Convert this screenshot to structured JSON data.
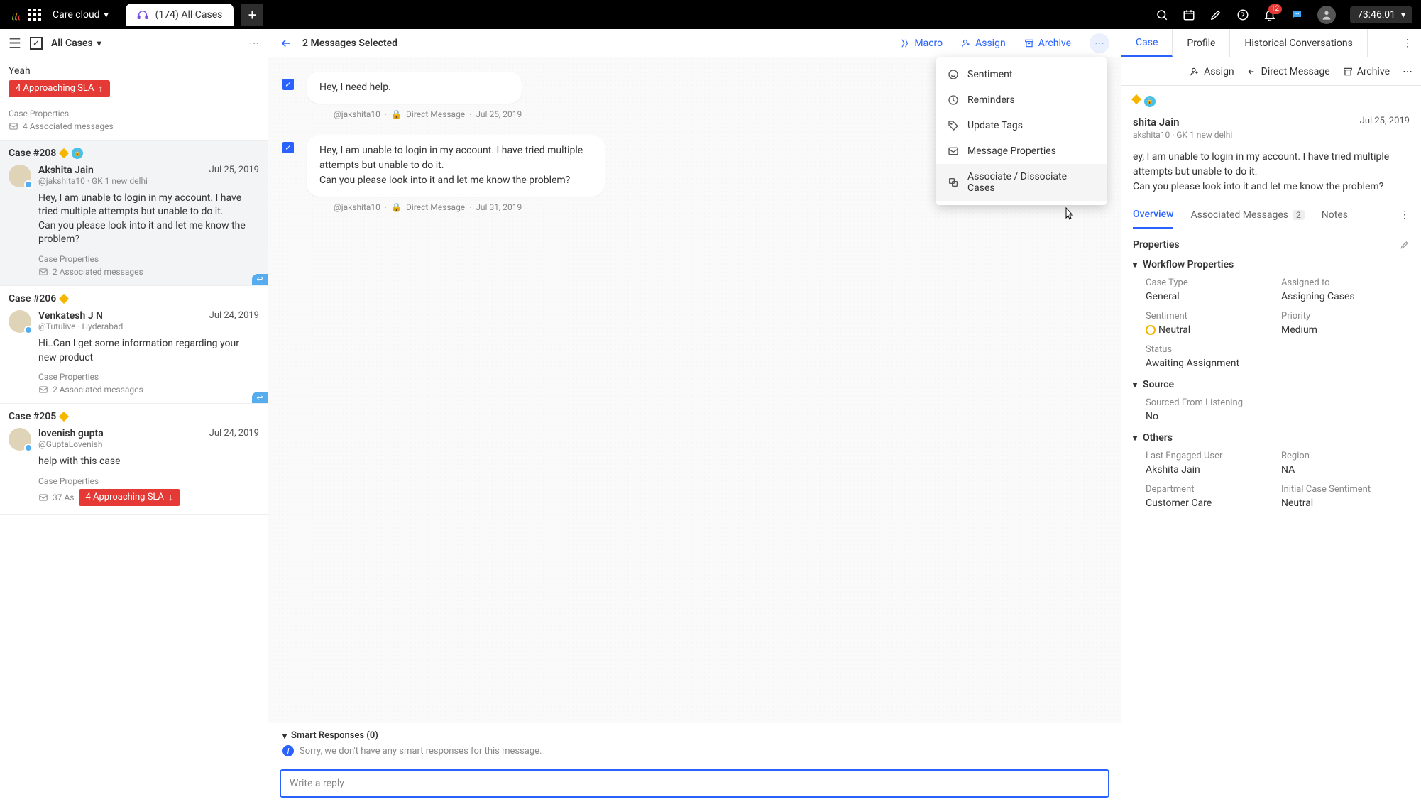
{
  "topbar": {
    "workspace": "Care cloud",
    "tab": {
      "label": "(174) All Cases"
    },
    "notif_count": "12",
    "timer": "73:46:01"
  },
  "cases_header": {
    "title": "All Cases"
  },
  "cases": [
    {
      "num": "",
      "author": "",
      "handle": "",
      "date": "",
      "text": "Yeah",
      "sla": "4 Approaching SLA",
      "case_props": "Case Properties",
      "assoc": "4 Associated messages"
    },
    {
      "num": "Case #208",
      "author": "Akshita Jain",
      "handle": "@jakshita10 · GK 1 new delhi",
      "date": "Jul 25, 2019",
      "text": "Hey, I am unable to login in my account. I have tried multiple attempts but unable to do it.\nCan you please look into it and let me know the problem?",
      "case_props": "Case Properties",
      "assoc": "2 Associated messages"
    },
    {
      "num": "Case #206",
      "author": "Venkatesh J N",
      "handle": "@Tutulive · Hyderabad",
      "date": "Jul 24, 2019",
      "text": "Hi..Can I get some information regarding your new product",
      "case_props": "Case Properties",
      "assoc": "2 Associated messages"
    },
    {
      "num": "Case #205",
      "author": "lovenish gupta",
      "handle": "@GuptaLovenish",
      "date": "Jul 24, 2019",
      "text": "help with this case",
      "case_props": "Case Properties",
      "assoc_partial": "37 As",
      "sla": "4 Approaching SLA"
    }
  ],
  "msgs_header": {
    "title": "2 Messages Selected",
    "macro": "Macro",
    "assign": "Assign",
    "archive": "Archive"
  },
  "messages": [
    {
      "text": "Hey, I need help.",
      "handle": "@jakshita10",
      "channel": "Direct Message",
      "date": "Jul 25, 2019"
    },
    {
      "text": "Hey, I am unable to login in my account. I have tried multiple attempts but unable to do it.\nCan you please look into it and let me know the problem?",
      "handle": "@jakshita10",
      "channel": "Direct Message",
      "date": "Jul 31, 2019"
    }
  ],
  "dropdown": [
    "Sentiment",
    "Reminders",
    "Update Tags",
    "Message Properties",
    "Associate / Dissociate Cases"
  ],
  "smart": {
    "header": "Smart Responses (0)",
    "info": "Sorry, we don't have any smart responses for this message."
  },
  "reply_placeholder": "Write a reply",
  "detail": {
    "tabs": {
      "case": "Case",
      "profile": "Profile",
      "hist": "Historical Conversations"
    },
    "actions": {
      "assign": "Assign",
      "dm": "Direct Message",
      "archive": "Archive"
    },
    "name": "Akshita Jain",
    "name_partial": "shita Jain",
    "date": "Jul 25, 2019",
    "handle_partial": "akshita10 · GK 1 new delhi",
    "msg_partial": "ey, I am unable to login in my account. I have tried multiple attempts but unable to do it.\nCan you please look into it and let me know the problem?",
    "subtabs": {
      "overview": "Overview",
      "assoc": "Associated Messages",
      "assoc_count": "2",
      "notes": "Notes"
    },
    "properties_header": "Properties",
    "workflow_header": "Workflow Properties",
    "workflow": {
      "case_type_l": "Case Type",
      "case_type": "General",
      "assigned_l": "Assigned to",
      "assigned": "Assigning Cases",
      "sentiment_l": "Sentiment",
      "sentiment": "Neutral",
      "priority_l": "Priority",
      "priority": "Medium",
      "status_l": "Status",
      "status": "Awaiting Assignment"
    },
    "source_header": "Source",
    "source": {
      "label": "Sourced From Listening",
      "value": "No"
    },
    "others_header": "Others",
    "others": {
      "engaged_l": "Last Engaged User",
      "engaged": "Akshita Jain",
      "region_l": "Region",
      "region": "NA",
      "dept_l": "Department",
      "dept": "Customer Care",
      "icase_l": "Initial Case Sentiment",
      "icase": "Neutral"
    }
  }
}
